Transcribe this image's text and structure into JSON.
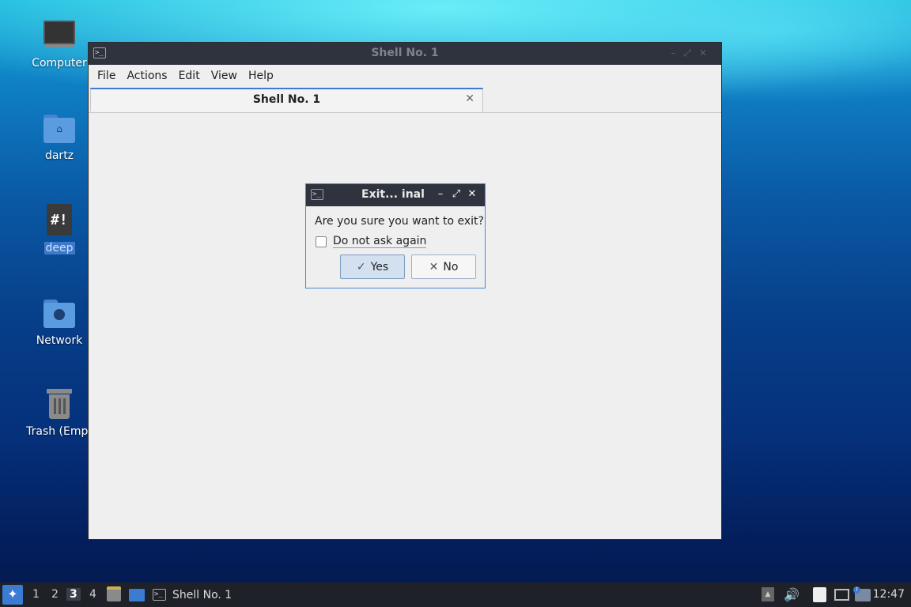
{
  "desktop": {
    "icons": [
      {
        "label": "Computer"
      },
      {
        "label": "dartz"
      },
      {
        "label": "deep"
      },
      {
        "label": "Network"
      },
      {
        "label": "Trash (Empt"
      }
    ]
  },
  "terminal": {
    "title": "Shell No. 1",
    "menu": [
      "File",
      "Actions",
      "Edit",
      "View",
      "Help"
    ],
    "tab": {
      "label": "Shell No. 1",
      "close": "✕"
    }
  },
  "dialog": {
    "title": "Exit...  inal",
    "message": "Are you sure you want to exit?",
    "checkbox": {
      "label": "Do not ask again",
      "checked": false
    },
    "yes_label": "Yes",
    "no_label": "No"
  },
  "taskbar": {
    "workspaces": [
      "1",
      "2",
      "3",
      "4"
    ],
    "active_workspace": "3",
    "task_label": "Shell No. 1",
    "clock": "12:47"
  },
  "colors": {
    "accent": "#3b7bd1",
    "titlebar": "#2f333d",
    "taskbar": "#1e2128"
  }
}
